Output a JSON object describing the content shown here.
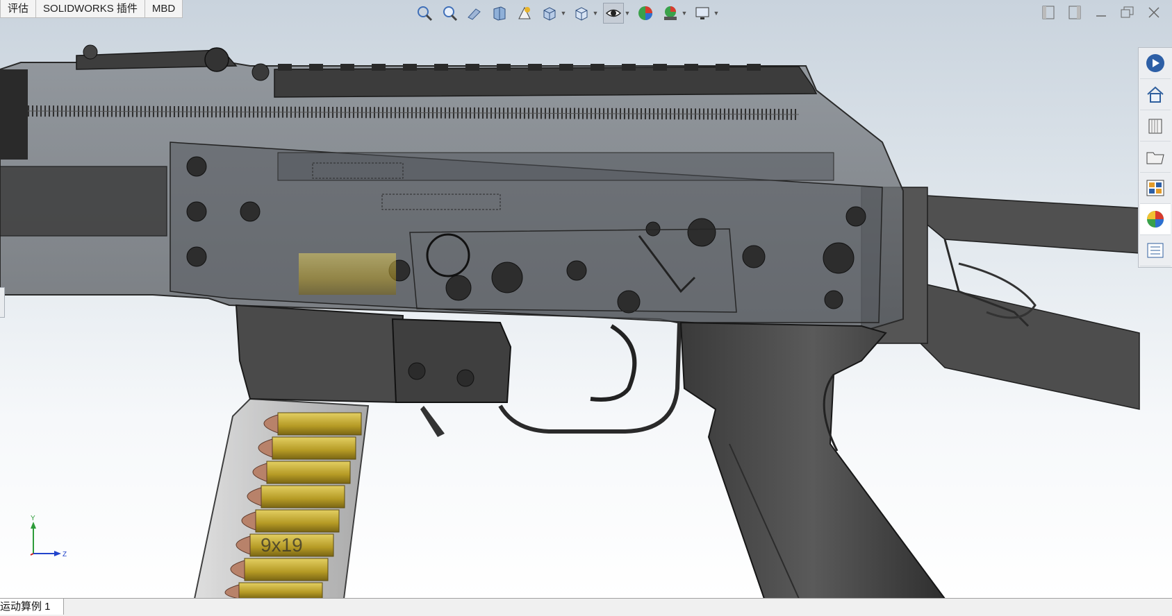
{
  "tabs": [
    {
      "label": "评估"
    },
    {
      "label": "SOLIDWORKS 插件"
    },
    {
      "label": "MBD"
    }
  ],
  "heads_up_toolbar": [
    {
      "icon": "zoom-to-fit-icon"
    },
    {
      "icon": "zoom-to-area-icon"
    },
    {
      "icon": "previous-view-icon"
    },
    {
      "icon": "section-view-icon"
    },
    {
      "icon": "dynamic-annotation-views-icon"
    },
    {
      "icon": "view-orientation-icon"
    },
    {
      "icon": "display-style-icon"
    },
    {
      "icon": "hide-show-items-icon",
      "active": true
    },
    {
      "icon": "edit-appearance-icon"
    },
    {
      "icon": "apply-scene-icon"
    },
    {
      "icon": "view-settings-icon"
    }
  ],
  "window_controls": [
    "tile-left-icon",
    "tile-right-icon",
    "minimize-icon",
    "restore-icon",
    "close-icon"
  ],
  "task_pane": [
    {
      "icon": "solidworks-resources-icon"
    },
    {
      "icon": "home-icon"
    },
    {
      "icon": "design-library-icon"
    },
    {
      "icon": "file-explorer-icon"
    },
    {
      "icon": "view-palette-icon"
    },
    {
      "icon": "appearances-scenes-icon",
      "active": true
    },
    {
      "icon": "custom-properties-icon"
    }
  ],
  "model": {
    "magazine_label": "9x19",
    "colors": {
      "receiver": "#4a4a4a",
      "receiver_dark": "#2d2d2d",
      "transparent_body": "#6f7378",
      "brass": "#c2a635",
      "copper": "#b8826a"
    }
  },
  "triad": {
    "y_label": "Y",
    "z_label": "Z"
  },
  "status_tab": {
    "label": "运动算例 1"
  }
}
